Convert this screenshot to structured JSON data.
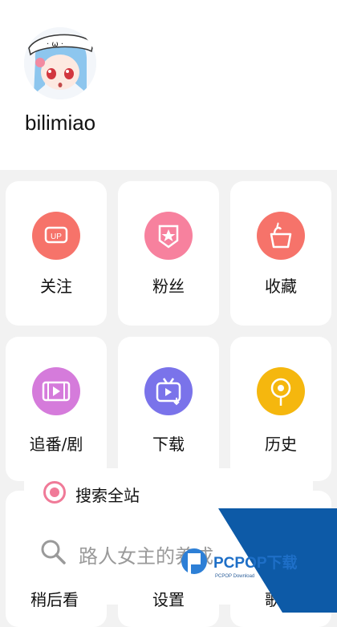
{
  "profile": {
    "username": "bilimiao"
  },
  "tiles": [
    {
      "label": "关注",
      "icon": "up-badge-icon",
      "color": "#f6736a"
    },
    {
      "label": "粉丝",
      "icon": "star-badge-icon",
      "color": "#f7819e"
    },
    {
      "label": "收藏",
      "icon": "basket-icon",
      "color": "#f6736a"
    },
    {
      "label": "追番/剧",
      "icon": "film-strip-icon",
      "color": "#d57bdb"
    },
    {
      "label": "下载",
      "icon": "tv-download-icon",
      "color": "#7a73ea"
    },
    {
      "label": "历史",
      "icon": "location-history-icon",
      "color": "#f5b70e"
    }
  ],
  "search": {
    "scope_label": "搜索全站",
    "placeholder": "路人女主的养成"
  },
  "bottom_row": [
    "稍后看",
    "设置",
    "歌词"
  ],
  "watermark": {
    "brand": "PCPOP下载",
    "sub": "PCPOP Download"
  },
  "colors": {
    "accent": "#f07a98",
    "background": "#f2f2f2",
    "watermark_blue": "#0d5aa7"
  }
}
